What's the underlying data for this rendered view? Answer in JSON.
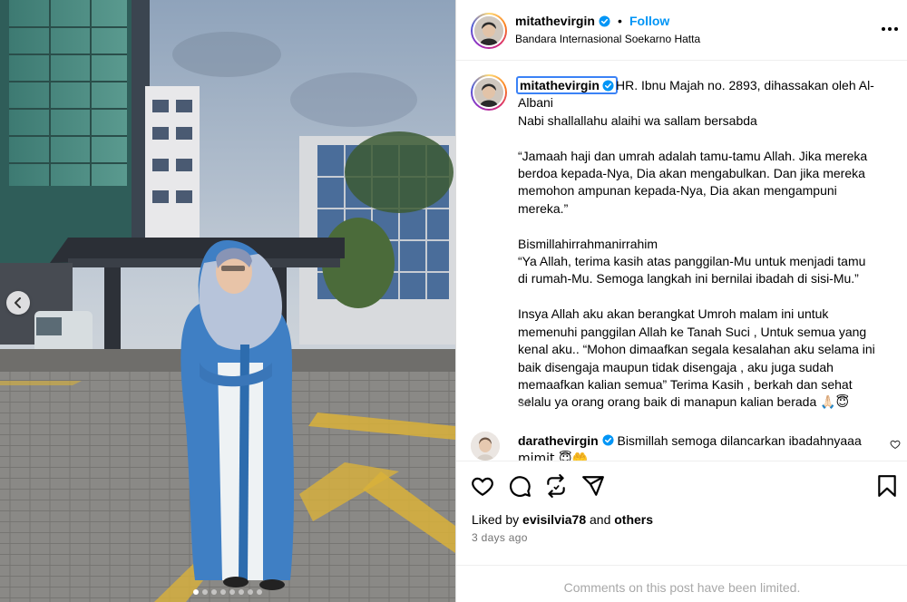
{
  "post": {
    "username": "mitathevirgin",
    "separator": "•",
    "follow_label": "Follow",
    "location": "Bandara Internasional Soekarno Hatta",
    "caption_first_line": "HR. Ibnu Majah no. 2893, dihassakan oleh Al-",
    "caption_lines": [
      "Albani",
      "Nabi shallallahu alaihi wa sallam bersabda",
      "",
      "“Jamaah haji dan umrah adalah tamu-tamu Allah. Jika mereka",
      "berdoa kepada-Nya, Dia akan mengabulkan. Dan jika mereka",
      "memohon ampunan kepada-Nya, Dia akan mengampuni",
      "mereka.”",
      "",
      "Bismillahirrahmanirrahim",
      "“Ya Allah, terima kasih atas panggilan-Mu untuk menjadi tamu",
      "di rumah-Mu. Semoga langkah ini bernilai ibadah di sisi-Mu.”",
      "",
      "Insya Allah aku akan berangkat Umroh malam ini untuk",
      "memenuhi panggilan Allah ke Tanah Suci , Untuk semua yang",
      "kenal aku.. “Mohon dimaafkan segala kesalahan aku selama ini",
      "baik disengaja maupun tidak disengaja , aku juga sudah",
      "memaafkan kalian semua” Terima Kasih , berkah dan sehat",
      "selalu ya orang orang baik di manapun kalian berada 🙏🏻😇"
    ],
    "time_ago": "3d"
  },
  "comment": {
    "username": "darathevirgin",
    "text": "Bismillah semoga dilancarkan ibadahnyaaa",
    "text2": "mimit 😇🤲"
  },
  "footer": {
    "liked_prefix": "Liked by",
    "liked_user": "evisilvia78",
    "liked_and": "and",
    "liked_others": "others",
    "date": "3 days ago",
    "limited_text": "Comments on this post have been limited."
  },
  "carousel": {
    "dot_count": 8,
    "active_index": 0
  },
  "colors": {
    "accent": "#0095f6",
    "verified": "#0095f6",
    "muted": "#737373",
    "limited": "#a8a8a8"
  },
  "icons": [
    "heart-icon",
    "comment-icon",
    "share-icon",
    "send-icon",
    "bookmark-icon",
    "more-options-icon",
    "chevron-left-icon",
    "verified-badge-icon"
  ]
}
